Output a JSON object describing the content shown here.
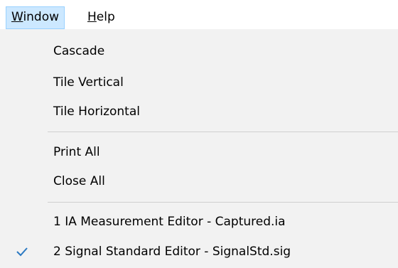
{
  "menubar": {
    "window": {
      "label": "indow",
      "mnemonic": "W"
    },
    "help": {
      "label": "elp",
      "mnemonic": "H"
    }
  },
  "window_menu": {
    "items": [
      {
        "label": "Cascade"
      },
      {
        "label": "Tile Vertical"
      },
      {
        "label": "Tile Horizontal"
      },
      {
        "label": "Print All"
      },
      {
        "label": "Close All"
      },
      {
        "label": "1 IA Measurement Editor - Captured.ia"
      },
      {
        "label": "2 Signal Standard Editor - SignalStd.sig",
        "checked": true
      }
    ]
  },
  "colors": {
    "menu_background": "#f2f2f2",
    "active_highlight": "#cce8ff",
    "active_border": "#99d1ff",
    "check": "#2b79c2"
  },
  "icons": {
    "check": "checkmark-icon"
  }
}
